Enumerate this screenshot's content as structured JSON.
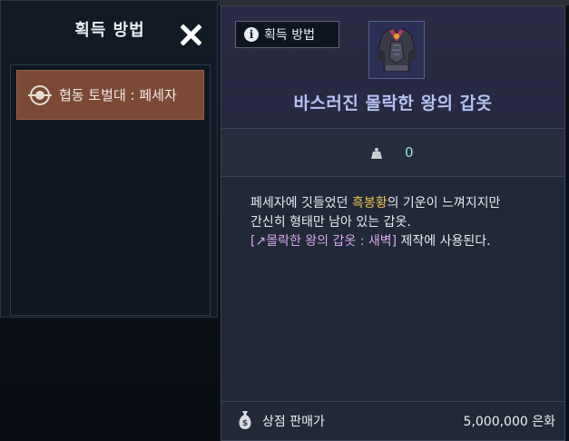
{
  "acquisition_panel": {
    "title": "획득 방법",
    "sources": [
      {
        "label": "협동 토벌대 : 페세자",
        "icon": "raid-emblem-icon"
      }
    ]
  },
  "item_tooltip": {
    "obtain_button_label": "획득 방법",
    "info_icon_glyph": "i",
    "item_name": "바스러진 몰락한 왕의 갑옷",
    "item_icon": "dark-armor-icon",
    "weight": "0",
    "description": {
      "line1_before": "페세자에 깃들었던 ",
      "line1_highlight": "흑봉황",
      "line1_after": "의 기운이 느껴지지만",
      "line2": "간신히 형태만 남아 있는 갑옷.",
      "line3_link": "[↗몰락한 왕의 갑옷 : 새벽]",
      "line3_after": " 제작에 사용된다."
    },
    "shop_price_label": "상점 판매가",
    "shop_price_value": "5,000,000 은화"
  },
  "colors": {
    "item_name": "#b6c2f2",
    "highlight": "#f0c44e",
    "link": "#d9a8ee",
    "weight_value": "#8fe6d8",
    "source_item_bg": "#7a4a35"
  }
}
